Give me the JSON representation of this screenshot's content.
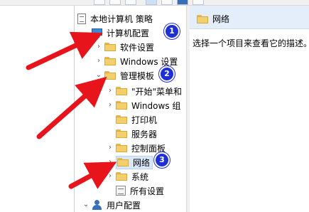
{
  "tree": {
    "root": "本地计算机 策略",
    "computer_config": "计算机配置",
    "software_settings": "软件设置",
    "windows_settings": "Windows 设置",
    "admin_templates": "管理模板",
    "start_menu": "\"开始\"菜单和",
    "windows_components": "Windows 组",
    "printers": "打印机",
    "servers": "服务器",
    "control_panel": "控制面板",
    "network": "网络",
    "system": "系统",
    "all_settings": "所有设置",
    "user_config": "用户配置"
  },
  "right_pane": {
    "header": "网络",
    "description": "选择一个项目来查看它的描述。"
  },
  "annotations": [
    "1",
    "2",
    "3"
  ],
  "colors": {
    "arrow": "#e8141b",
    "badge": "#1f2fd6"
  }
}
